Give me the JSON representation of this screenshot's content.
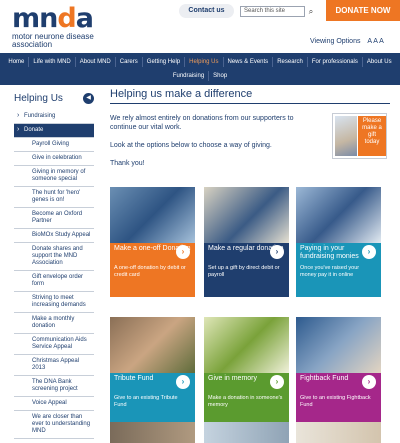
{
  "header": {
    "logo": {
      "text_blue": "mn",
      "text_orange": "d",
      "text_blue2": "a",
      "subtitle_line1": "motor neurone disease",
      "subtitle_line2": "association"
    },
    "contact_label": "Contact us",
    "search_placeholder": "Search this site",
    "donate_label": "DONATE NOW",
    "viewing_options": "Viewing Options",
    "text_size_label": "A A A"
  },
  "nav": {
    "row1": [
      "Home",
      "Life with MND",
      "About MND",
      "Carers",
      "Getting Help",
      "Helping Us",
      "News & Events",
      "Research",
      "For professionals",
      "About Us"
    ],
    "row2": [
      "Fundraising",
      "Shop"
    ],
    "active": "Helping Us"
  },
  "sidebar": {
    "title": "Helping Us",
    "items": [
      {
        "label": "Fundraising",
        "level": 1
      },
      {
        "label": "Donate",
        "level": 1,
        "selected": true
      },
      {
        "label": "Payroll Giving",
        "level": 2
      },
      {
        "label": "Give in celebration",
        "level": 2
      },
      {
        "label": "Giving in memory of someone special",
        "level": 2
      },
      {
        "label": "The hunt for 'hero' genes is on!",
        "level": 2
      },
      {
        "label": "Become an Oxford Partner",
        "level": 2
      },
      {
        "label": "BioMOx Study Appeal",
        "level": 2
      },
      {
        "label": "Donate shares and support the MND Association",
        "level": 2
      },
      {
        "label": "Gift envelope order form",
        "level": 2
      },
      {
        "label": "Striving to meet increasing demands",
        "level": 2
      },
      {
        "label": "Make a monthly donation",
        "level": 2
      },
      {
        "label": "Communication Aids Service Appeal",
        "level": 2
      },
      {
        "label": "Christmas Appeal 2013",
        "level": 2
      },
      {
        "label": "The DNA Bank screening project",
        "level": 2
      },
      {
        "label": "Voice Appeal",
        "level": 2
      },
      {
        "label": "We are closer than ever to understanding MND",
        "level": 2
      }
    ]
  },
  "main": {
    "title": "Helping us make a difference",
    "intro": [
      "We rely almost entirely on donations from our supporters to continue our vital work.",
      "Look at the options below to choose a way of giving.",
      "Thank you!"
    ],
    "promo_text": "Please make a gift today"
  },
  "cards": [
    {
      "title": "Make a one-off Donation",
      "sub": "A one-off donation by debit or credit card",
      "color": "#ee7623",
      "arrow_color": "#ee7623"
    },
    {
      "title": "Make a regular donation",
      "sub": "Set up a gift by direct debit or payroll",
      "color": "#1f3e6e",
      "arrow_color": "#1f3e6e"
    },
    {
      "title": "Paying in your fundraising monies",
      "sub": "Once you've raised your money pay it in online",
      "color": "#1a95b8",
      "arrow_color": "#1a95b8"
    },
    {
      "title": "Tribute Fund",
      "sub": "Give to an existing Tribute Fund",
      "color": "#1a95b8",
      "arrow_color": "#1a95b8"
    },
    {
      "title": "Give in memory",
      "sub": "Make a donation in someone's memory",
      "color": "#5b9b2f",
      "arrow_color": "#5b9b2f"
    },
    {
      "title": "Fightback Fund",
      "sub": "Give to an existing Fightback Fund",
      "color": "#a5278a",
      "arrow_color": "#a5278a"
    }
  ]
}
